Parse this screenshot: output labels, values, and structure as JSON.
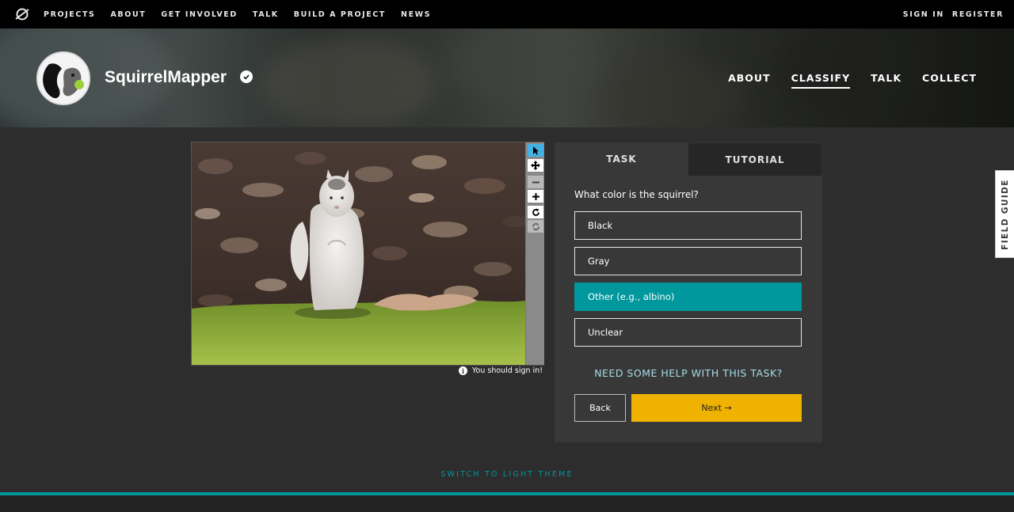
{
  "topnav": {
    "links": [
      "PROJECTS",
      "ABOUT",
      "GET INVOLVED",
      "TALK",
      "BUILD A PROJECT",
      "NEWS"
    ],
    "sign_in": "SIGN IN",
    "register": "REGISTER"
  },
  "project": {
    "title": "SquirrelMapper",
    "nav": [
      "ABOUT",
      "CLASSIFY",
      "TALK",
      "COLLECT"
    ],
    "active_nav": "CLASSIFY"
  },
  "viewer": {
    "tools": [
      "pointer-icon",
      "pan-icon",
      "zoom-out-icon",
      "zoom-in-icon",
      "rotate-icon",
      "reset-icon"
    ],
    "sign_in_note": "You should sign in!"
  },
  "task": {
    "tabs": [
      "TASK",
      "TUTORIAL"
    ],
    "question": "What color is the squirrel?",
    "answers": [
      "Black",
      "Gray",
      "Other (e.g., albino)",
      "Unclear"
    ],
    "selected_answer": "Other (e.g., albino)",
    "help_link": "NEED SOME HELP WITH THIS TASK?",
    "back_label": "Back",
    "next_label": "Next →"
  },
  "field_guide": "FIELD GUIDE",
  "footer": {
    "theme_switch": "SWITCH TO LIGHT THEME"
  },
  "colors": {
    "accent_teal": "#00979d",
    "next_button": "#f0b200",
    "selected_tool": "#43b1e3"
  }
}
